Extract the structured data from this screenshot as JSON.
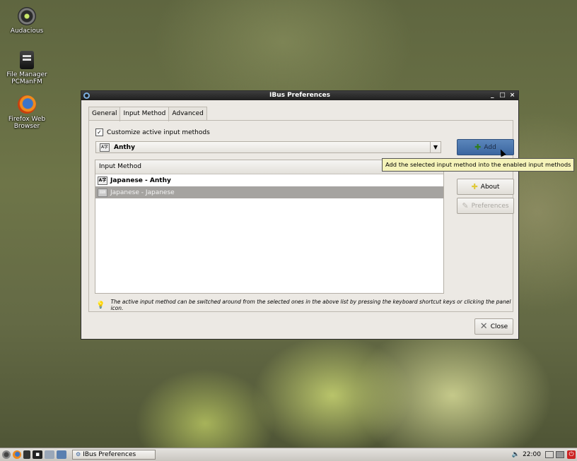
{
  "desktop": {
    "icons": [
      {
        "label": "Audacious",
        "icon": "audacious-icon"
      },
      {
        "label": "File Manager PCManFM",
        "icon": "file-manager-icon"
      },
      {
        "label": "Firefox Web Browser",
        "icon": "firefox-icon"
      }
    ]
  },
  "window": {
    "title": "IBus Preferences",
    "controls": [
      "_",
      "□",
      "×"
    ],
    "tabs": [
      {
        "label": "General",
        "active": false
      },
      {
        "label": "Input Method",
        "active": true
      },
      {
        "label": "Advanced",
        "active": false
      }
    ],
    "customize_label": "Customize active input methods",
    "customize_checked": true,
    "combo_value": "Anthy",
    "list_header": "Input Method",
    "rows": [
      {
        "label": "Japanese - Anthy",
        "bold": true,
        "selected": false
      },
      {
        "label": "Japanese - Japanese",
        "bold": false,
        "selected": true
      }
    ],
    "buttons": {
      "add": "Add",
      "about": "About",
      "preferences": "Preferences"
    },
    "hint": "The active input method can be switched around from the selected ones in the above list by pressing the keyboard shortcut keys or clicking the panel icon.",
    "close": "Close"
  },
  "tooltip": "Add the selected input method into the enabled input methods",
  "taskbar": {
    "task_label": "IBus Preferences",
    "clock": "22:00"
  }
}
